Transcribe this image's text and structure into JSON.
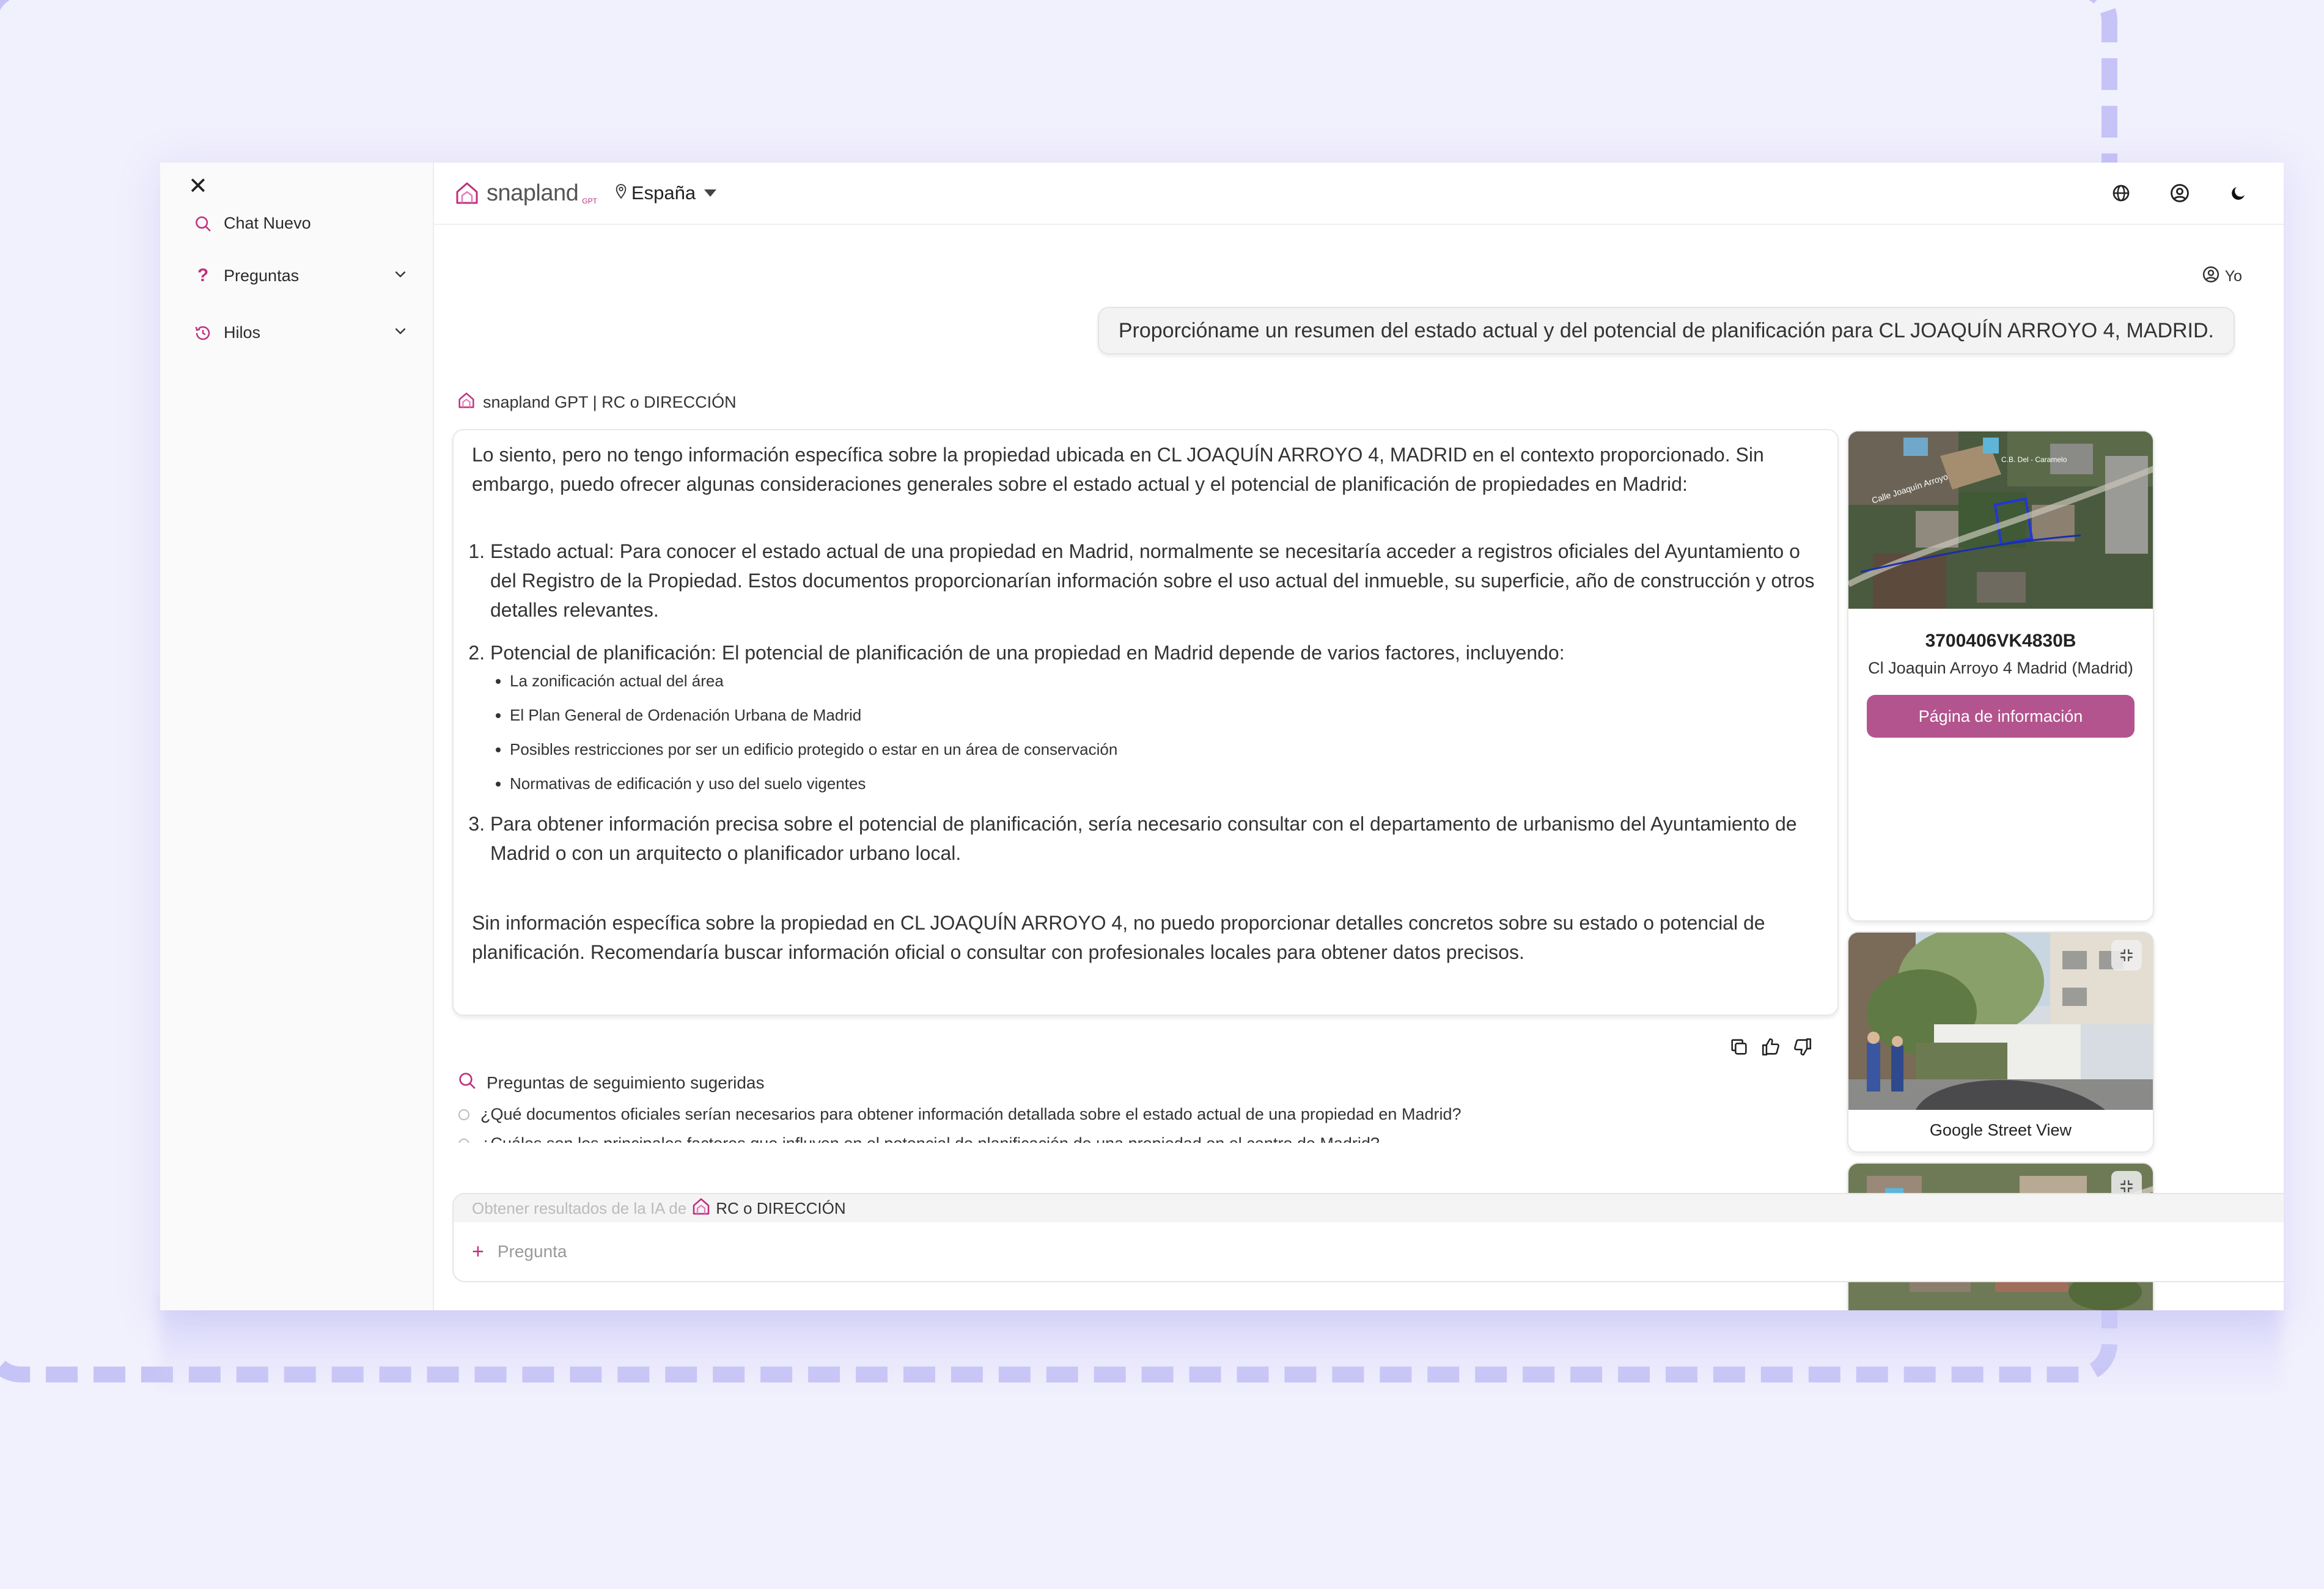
{
  "colors": {
    "accent": "#c0307f",
    "button": "#b3548f",
    "frame": "#c6c4f6"
  },
  "sidebar": {
    "close_icon": "close-icon",
    "items": [
      {
        "label": "Chat Nuevo",
        "icon": "search-icon"
      },
      {
        "label": "Preguntas",
        "icon": "question-icon"
      },
      {
        "label": "Hilos",
        "icon": "history-icon"
      }
    ]
  },
  "header": {
    "brand": "snapland",
    "brand_sub": "GPT",
    "country": "España",
    "icons": [
      "globe-icon",
      "user-circle-icon",
      "moon-icon"
    ]
  },
  "chat": {
    "user_label": "Yo",
    "user_message": "Proporcióname un resumen del estado actual y del potencial de planificación para CL JOAQUÍN ARROYO 4, MADRID.",
    "bot_label": "snapland GPT | RC o DIRECCIÓN",
    "answer": {
      "intro": "Lo siento, pero no tengo información específica sobre la propiedad ubicada en CL JOAQUÍN ARROYO 4, MADRID en el contexto proporcionado. Sin embargo, puedo ofrecer algunas consideraciones generales sobre el estado actual y el potencial de planificación de propiedades en Madrid:",
      "item1": "Estado actual: Para conocer el estado actual de una propiedad en Madrid, normalmente se necesitaría acceder a registros oficiales del Ayuntamiento o del Registro de la Propiedad. Estos documentos proporcionarían información sobre el uso actual del inmueble, su superficie, año de construcción y otros detalles relevantes.",
      "item2": "Potencial de planificación: El potencial de planificación de una propiedad en Madrid depende de varios factores, incluyendo:",
      "item2_bullets": [
        "La zonificación actual del área",
        "El Plan General de Ordenación Urbana de Madrid",
        "Posibles restricciones por ser un edificio protegido o estar en un área de conservación",
        "Normativas de edificación y uso del suelo vigentes"
      ],
      "item3": "Para obtener información precisa sobre el potencial de planificación, sería necesario consultar con el departamento de urbanismo del Ayuntamiento de Madrid o con un arquitecto o planificador urbano local.",
      "closing": "Sin información específica sobre la propiedad en CL JOAQUÍN ARROYO 4, no puedo proporcionar detalles concretos sobre su estado o potencial de planificación. Recomendaría buscar información oficial o consultar con profesionales locales para obtener datos precisos."
    },
    "feedback_icons": [
      "copy-icon",
      "thumbs-up-icon",
      "thumbs-down-icon"
    ],
    "suggestions_title": "Preguntas de seguimiento sugeridas",
    "suggestions": [
      "¿Qué documentos oficiales serían necesarios para obtener información detallada sobre el estado actual de una propiedad en Madrid?",
      "¿Cuáles son los principales factores que influyen en el potencial de planificación de una propiedad en el centro de Madrid?"
    ]
  },
  "property": {
    "rc": "3700406VK4830B",
    "address": "Cl Joaquin Arroyo 4 Madrid (Madrid)",
    "button": "Página de información",
    "map_labels": [
      "Calle Joaquín Arroyo",
      "C.B. Del - Caramelo"
    ],
    "street_view_caption": "Google Street View"
  },
  "composer": {
    "source_prefix": "Obtener resultados de la IA de",
    "source_value": "RC o DIRECCIÓN",
    "placeholder": "Pregunta"
  }
}
